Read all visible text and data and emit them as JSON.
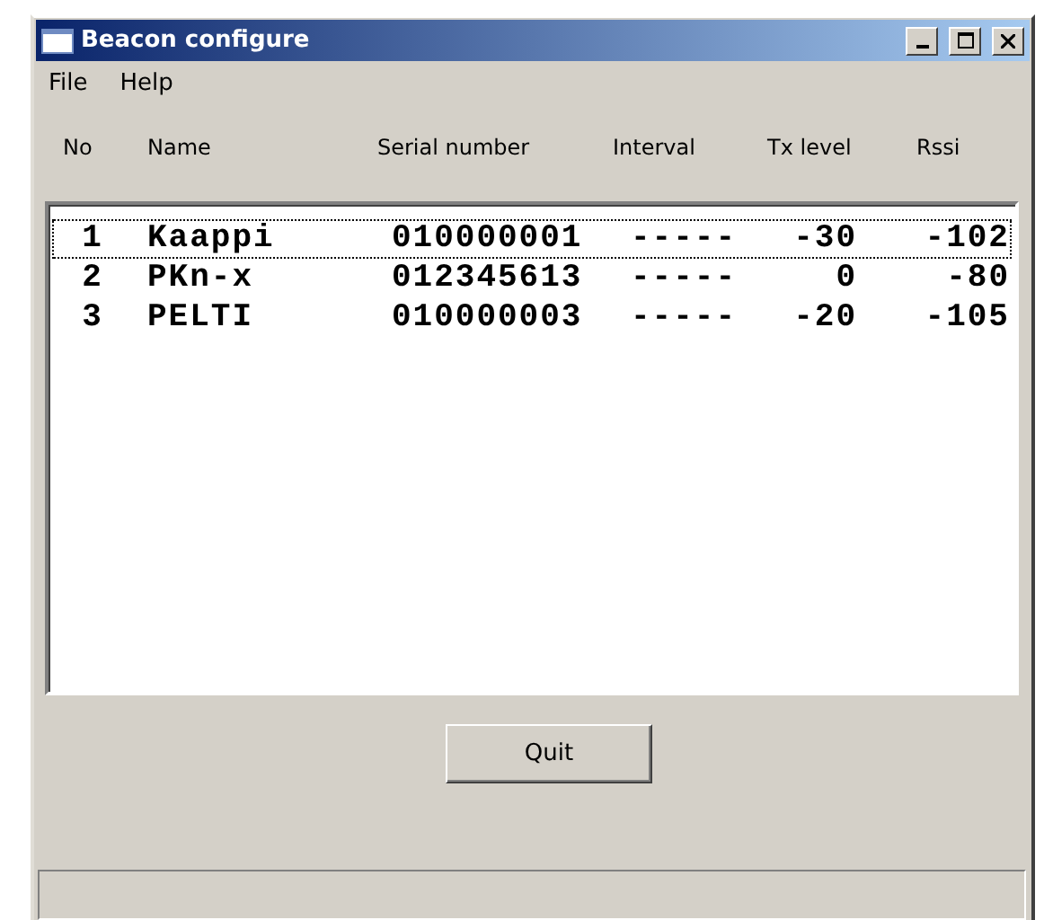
{
  "window": {
    "title": "Beacon configure"
  },
  "menu": [
    "File",
    "Help"
  ],
  "columns": [
    "No",
    "Name",
    "Serial number",
    "Interval",
    "Tx level",
    "Rssi"
  ],
  "rows": [
    {
      "no": "1",
      "name": "Kaappi",
      "serial": "010000001",
      "interval": "-----",
      "tx_level": "-30",
      "rssi": "-102",
      "focused": true
    },
    {
      "no": "2",
      "name": "PKn-x",
      "serial": "012345613",
      "interval": "-----",
      "tx_level": "0",
      "rssi": "-80",
      "focused": false
    },
    {
      "no": "3",
      "name": "PELTI",
      "serial": "010000003",
      "interval": "-----",
      "tx_level": "-20",
      "rssi": "-105",
      "focused": false
    }
  ],
  "buttons": [
    "Quit"
  ]
}
